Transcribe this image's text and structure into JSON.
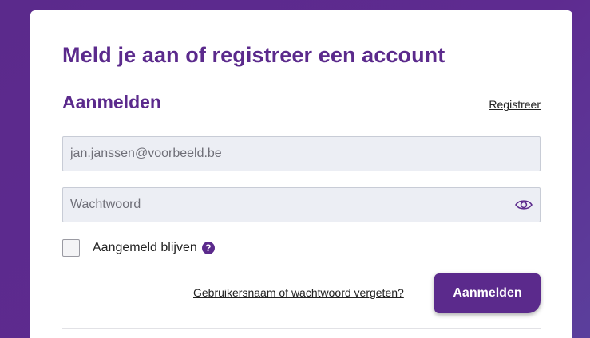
{
  "colors": {
    "brand": "#5b2a8c",
    "background": "#5e2b90",
    "card": "#ffffff",
    "field_bg": "#eceef4"
  },
  "page": {
    "title": "Meld je aan of registreer een account"
  },
  "login": {
    "heading": "Aanmelden",
    "register_link": "Registreer",
    "email_placeholder": "jan.janssen@voorbeeld.be",
    "email_value": "",
    "password_placeholder": "Wachtwoord",
    "password_value": "",
    "password_toggle_icon": "eye-icon",
    "remember_label": "Aangemeld blijven",
    "remember_checked": false,
    "help_icon": "question-icon",
    "help_glyph": "?",
    "forgot_link": "Gebruikersnaam of wachtwoord vergeten?",
    "submit_label": "Aanmelden"
  }
}
